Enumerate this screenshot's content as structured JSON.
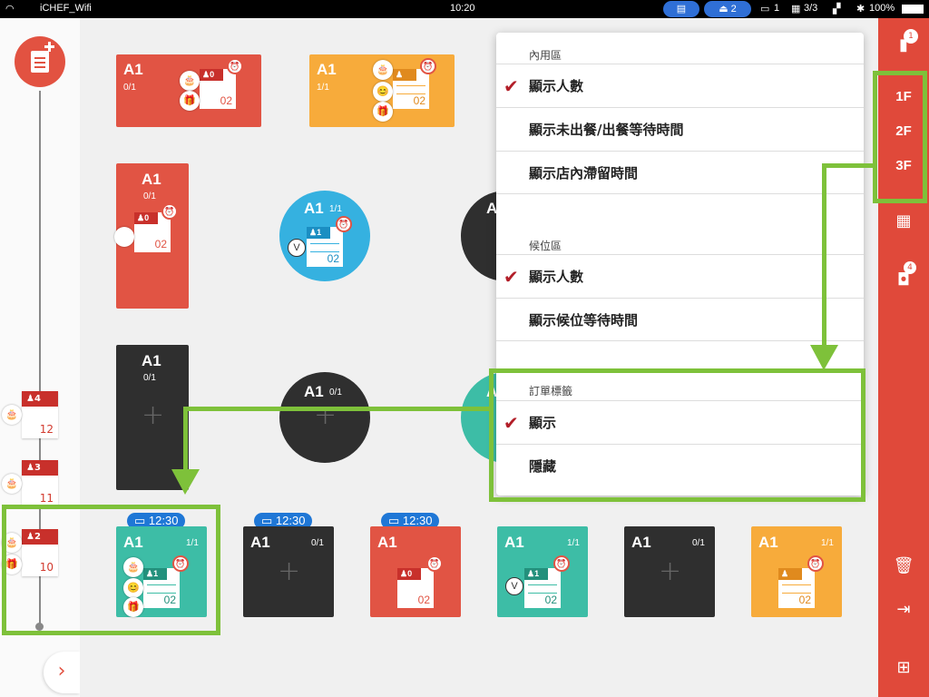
{
  "status_bar": {
    "wifi": "iCHEF_Wifi",
    "time": "10:20",
    "delivery_count": "2",
    "tables_count": "1",
    "printers": "3/3",
    "battery": "100%"
  },
  "left_rail": {
    "queue": [
      {
        "people": "4",
        "number": "12"
      },
      {
        "people": "3",
        "number": "11"
      },
      {
        "people": "2",
        "number": "10"
      }
    ]
  },
  "tables": [
    {
      "name": "A1",
      "count": "0/1",
      "people": "0",
      "number": "02"
    },
    {
      "name": "A1",
      "count": "1/1",
      "number": "02"
    },
    {
      "name": "A1",
      "count": "0/1",
      "people": "0",
      "number": "02"
    },
    {
      "name": "A1",
      "count": "1/1",
      "people": "1",
      "number": "02"
    },
    {
      "name": "A1",
      "count": "0/1"
    },
    {
      "name": "A1",
      "count": "0/1"
    },
    {
      "name": "A1",
      "count": "1/1",
      "people": "1",
      "number": "02",
      "time": "12:30"
    },
    {
      "name": "A1",
      "count": "0/1",
      "time": "12:30"
    },
    {
      "name": "A1",
      "count": "",
      "people": "0",
      "number": "02",
      "time": "12:30"
    },
    {
      "name": "A1",
      "count": "1/1",
      "people": "1",
      "number": "02"
    },
    {
      "name": "A1",
      "count": "0/1"
    },
    {
      "name": "A1",
      "count": "1/1",
      "number": "02"
    },
    {
      "name": "A"
    },
    {
      "name": "A"
    }
  ],
  "dropdown": {
    "dine_in": {
      "title": "內用區",
      "options": [
        "顯示人數",
        "顯示未出餐/出餐等待時間",
        "顯示店內滯留時間"
      ]
    },
    "waitlist": {
      "title": "候位區",
      "options": [
        "顯示人數",
        "顯示候位等待時間"
      ]
    },
    "order_label": {
      "title": "訂單標籤",
      "options": [
        "顯示",
        "隱藏"
      ]
    }
  },
  "right_bar": {
    "floors": [
      "1F",
      "2F",
      "3F"
    ],
    "notification_count": "1",
    "takeout_count": "4"
  },
  "colors": {
    "red": "#e15444",
    "orange": "#f7ab3b",
    "blue": "#35b1e0",
    "teal": "#3dbda6",
    "dark": "#2f2f2f",
    "highlight": "#7ec13a",
    "sidebar": "#e0493a"
  },
  "icons": [
    "wifi-icon",
    "delivery-icon",
    "table-icon",
    "printer-icon",
    "bluetooth-icon",
    "battery-icon",
    "add-order-icon",
    "alarm-icon",
    "person-icon",
    "calendar-icon",
    "bag-icon",
    "trash-icon",
    "logout-icon",
    "toolbox-icon",
    "check-icon",
    "plus-icon"
  ]
}
